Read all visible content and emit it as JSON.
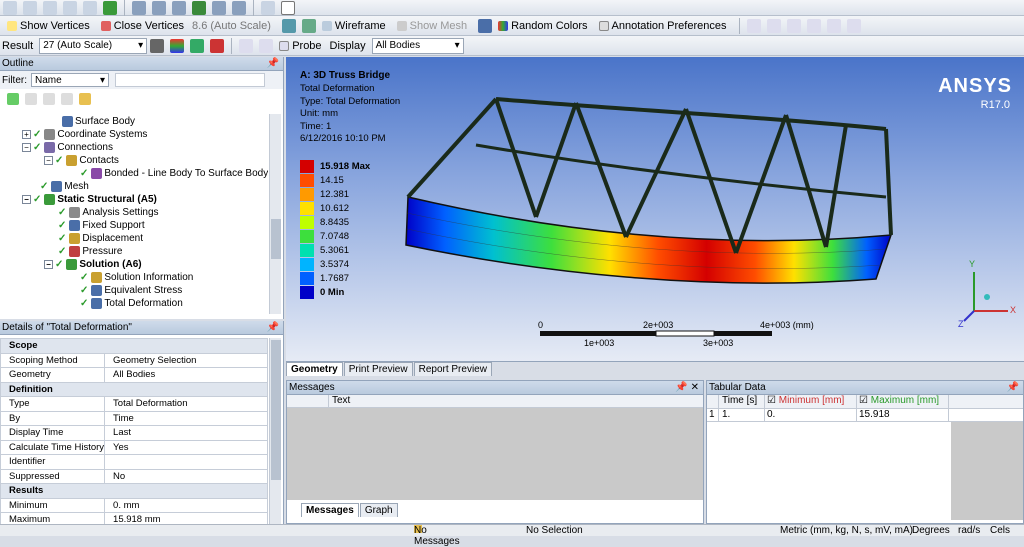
{
  "toolbar1": {
    "show_vertices": "Show Vertices",
    "close_vertices": "Close Vertices",
    "auto_scale": "8.6 (Auto Scale)",
    "wireframe": "Wireframe",
    "show_mesh": "Show Mesh",
    "random_colors": "Random Colors",
    "annotation_prefs": "Annotation Preferences"
  },
  "toolbar2": {
    "result_label": "Result",
    "result_scale": "27 (Auto Scale)",
    "probe": "Probe",
    "display_label": "Display",
    "display_value": "All Bodies"
  },
  "outline": {
    "title": "Outline",
    "filter_label": "Filter:",
    "filter_value": "Name",
    "items": [
      {
        "label": "Surface Body"
      },
      {
        "label": "Coordinate Systems"
      },
      {
        "label": "Connections"
      },
      {
        "label": "Contacts"
      },
      {
        "label": "Bonded - Line Body To Surface Body"
      },
      {
        "label": "Mesh"
      },
      {
        "label": "Static Structural (A5)"
      },
      {
        "label": "Analysis Settings"
      },
      {
        "label": "Fixed Support"
      },
      {
        "label": "Displacement"
      },
      {
        "label": "Pressure"
      },
      {
        "label": "Solution (A6)"
      },
      {
        "label": "Solution Information"
      },
      {
        "label": "Equivalent Stress"
      },
      {
        "label": "Total Deformation"
      }
    ]
  },
  "details": {
    "title": "Details of \"Total Deformation\"",
    "rows": [
      {
        "group": "Scope"
      },
      {
        "k": "Scoping Method",
        "v": "Geometry Selection"
      },
      {
        "k": "Geometry",
        "v": "All Bodies"
      },
      {
        "group": "Definition"
      },
      {
        "k": "Type",
        "v": "Total Deformation"
      },
      {
        "k": "By",
        "v": "Time"
      },
      {
        "k": "Display Time",
        "v": "Last"
      },
      {
        "k": "Calculate Time History",
        "v": "Yes"
      },
      {
        "k": "Identifier",
        "v": ""
      },
      {
        "k": "Suppressed",
        "v": "No"
      },
      {
        "group": "Results"
      },
      {
        "k": "Minimum",
        "v": "0. mm"
      },
      {
        "k": "Maximum",
        "v": "15.918 mm"
      }
    ]
  },
  "viewport": {
    "title": "A: 3D Truss Bridge",
    "info": [
      "Total Deformation",
      "Type: Total Deformation",
      "Unit: mm",
      "Time: 1",
      "6/12/2016 10:10 PM"
    ],
    "brand": "ANSYS",
    "version": "R17.0",
    "legend": [
      {
        "label": "15.918 Max",
        "color": "#d40000"
      },
      {
        "label": "14.15",
        "color": "#ff4d00"
      },
      {
        "label": "12.381",
        "color": "#ff9a00"
      },
      {
        "label": "10.612",
        "color": "#ffe000"
      },
      {
        "label": "8.8435",
        "color": "#bfff00"
      },
      {
        "label": "7.0748",
        "color": "#3ddf3d"
      },
      {
        "label": "5.3061",
        "color": "#00e0b0"
      },
      {
        "label": "3.5374",
        "color": "#00b4ff"
      },
      {
        "label": "1.7687",
        "color": "#0060ff"
      },
      {
        "label": "0 Min",
        "color": "#0000c8"
      }
    ],
    "scale": {
      "t0": "0",
      "t2": "2e+003",
      "t4": "4e+003 (mm)",
      "t1": "1e+003",
      "t3": "3e+003"
    },
    "tabs": [
      "Geometry",
      "Print Preview",
      "Report Preview"
    ]
  },
  "messages": {
    "title": "Messages",
    "col_text": "Text",
    "tabs": [
      "Messages",
      "Graph"
    ]
  },
  "tabular": {
    "title": "Tabular Data",
    "headers": [
      "Time [s]",
      "Minimum [mm]",
      "Maximum [mm]"
    ],
    "row": [
      "1",
      "1.",
      "0.",
      "15.918"
    ]
  },
  "status": {
    "messages": "No Messages",
    "selection": "No Selection",
    "units": "Metric (mm, kg, N, s, mV, mA)",
    "angle": "Degrees",
    "rate": "rad/s",
    "temp": "Cels"
  }
}
